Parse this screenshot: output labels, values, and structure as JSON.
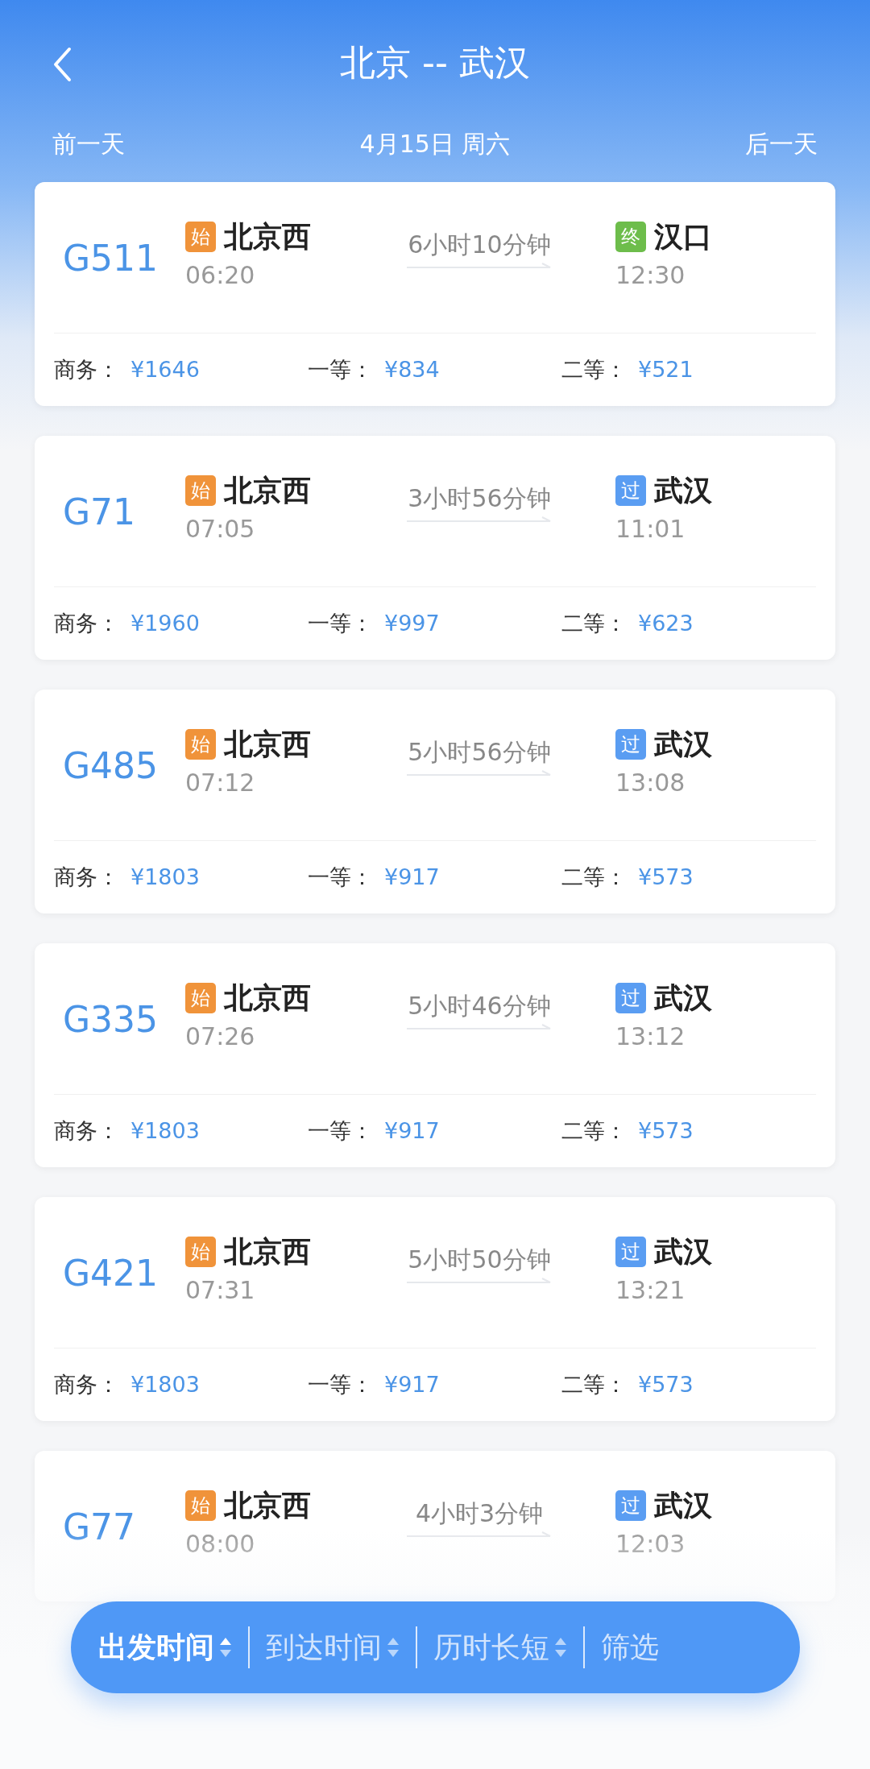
{
  "header": {
    "title": "北京 -- 武汉",
    "prev_day": "前一天",
    "date": "4月15日 周六",
    "next_day": "后一天"
  },
  "trains": [
    {
      "number": "G511",
      "from": {
        "badge": "始",
        "kind": "start",
        "station": "北京西",
        "time": "06:20"
      },
      "duration": "6小时10分钟",
      "to": {
        "badge": "终",
        "kind": "end",
        "station": "汉口",
        "time": "12:30"
      },
      "prices": [
        {
          "label": "商务：",
          "price": "¥1646"
        },
        {
          "label": "一等：",
          "price": "¥834"
        },
        {
          "label": "二等：",
          "price": "¥521"
        }
      ]
    },
    {
      "number": "G71",
      "from": {
        "badge": "始",
        "kind": "start",
        "station": "北京西",
        "time": "07:05"
      },
      "duration": "3小时56分钟",
      "to": {
        "badge": "过",
        "kind": "pass",
        "station": "武汉",
        "time": "11:01"
      },
      "prices": [
        {
          "label": "商务：",
          "price": "¥1960"
        },
        {
          "label": "一等：",
          "price": "¥997"
        },
        {
          "label": "二等：",
          "price": "¥623"
        }
      ]
    },
    {
      "number": "G485",
      "from": {
        "badge": "始",
        "kind": "start",
        "station": "北京西",
        "time": "07:12"
      },
      "duration": "5小时56分钟",
      "to": {
        "badge": "过",
        "kind": "pass",
        "station": "武汉",
        "time": "13:08"
      },
      "prices": [
        {
          "label": "商务：",
          "price": "¥1803"
        },
        {
          "label": "一等：",
          "price": "¥917"
        },
        {
          "label": "二等：",
          "price": "¥573"
        }
      ]
    },
    {
      "number": "G335",
      "from": {
        "badge": "始",
        "kind": "start",
        "station": "北京西",
        "time": "07:26"
      },
      "duration": "5小时46分钟",
      "to": {
        "badge": "过",
        "kind": "pass",
        "station": "武汉",
        "time": "13:12"
      },
      "prices": [
        {
          "label": "商务：",
          "price": "¥1803"
        },
        {
          "label": "一等：",
          "price": "¥917"
        },
        {
          "label": "二等：",
          "price": "¥573"
        }
      ]
    },
    {
      "number": "G421",
      "from": {
        "badge": "始",
        "kind": "start",
        "station": "北京西",
        "time": "07:31"
      },
      "duration": "5小时50分钟",
      "to": {
        "badge": "过",
        "kind": "pass",
        "station": "武汉",
        "time": "13:21"
      },
      "prices": [
        {
          "label": "商务：",
          "price": "¥1803"
        },
        {
          "label": "一等：",
          "price": "¥917"
        },
        {
          "label": "二等：",
          "price": "¥573"
        }
      ]
    },
    {
      "number": "G77",
      "from": {
        "badge": "始",
        "kind": "start",
        "station": "北京西",
        "time": "08:00"
      },
      "duration": "4小时3分钟",
      "to": {
        "badge": "过",
        "kind": "pass",
        "station": "武汉",
        "time": "12:03"
      }
    }
  ],
  "sort_bar": [
    {
      "label": "出发时间",
      "kind": "sort",
      "selected": true
    },
    {
      "label": "到达时间",
      "kind": "sort",
      "selected": false
    },
    {
      "label": "历时长短",
      "kind": "sort",
      "selected": false
    },
    {
      "label": "筛选",
      "kind": "filter",
      "selected": false
    }
  ]
}
